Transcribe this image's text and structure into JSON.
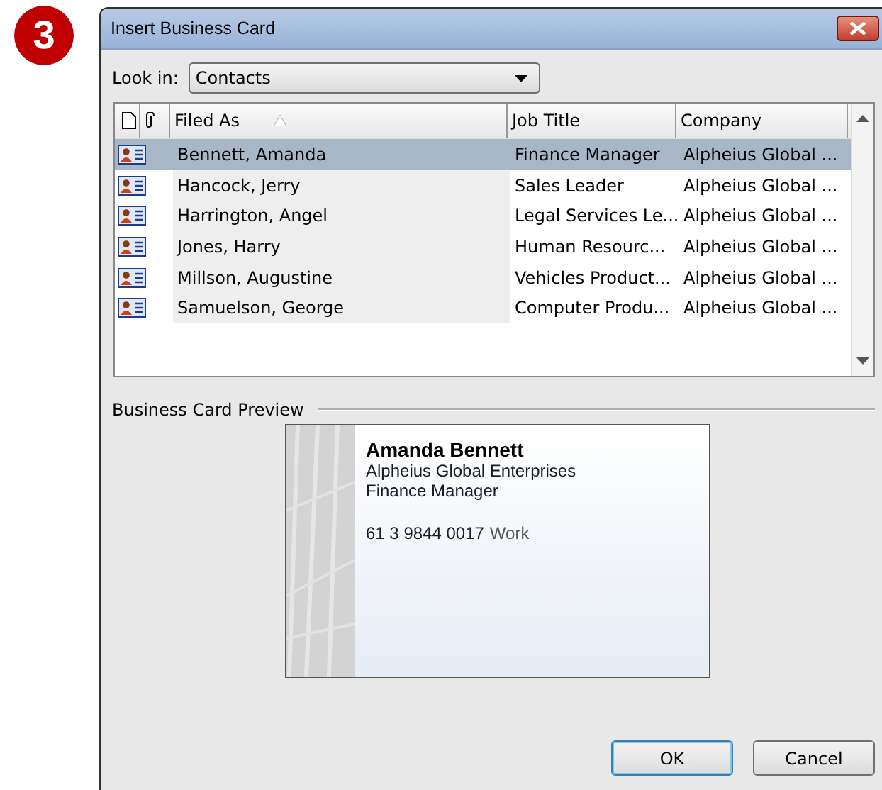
{
  "step_badge": "3",
  "window": {
    "title": "Insert Business Card"
  },
  "look_in": {
    "label": "Look in:",
    "value": "Contacts"
  },
  "table": {
    "columns": [
      "Filed As",
      "Job Title",
      "Company"
    ],
    "rows": [
      {
        "filed_as": "Bennett, Amanda",
        "job_title": "Finance Manager",
        "company": "Alpheius Global ...",
        "selected": true
      },
      {
        "filed_as": "Hancock, Jerry",
        "job_title": "Sales Leader",
        "company": "Alpheius Global ...",
        "selected": false
      },
      {
        "filed_as": "Harrington, Angel",
        "job_title": "Legal Services Le...",
        "company": "Alpheius Global ...",
        "selected": false
      },
      {
        "filed_as": "Jones, Harry",
        "job_title": "Human Resourc...",
        "company": "Alpheius Global ...",
        "selected": false
      },
      {
        "filed_as": "Millson, Augustine",
        "job_title": "Vehicles Product...",
        "company": "Alpheius Global ...",
        "selected": false
      },
      {
        "filed_as": "Samuelson, George",
        "job_title": "Computer Produ...",
        "company": "Alpheius Global ...",
        "selected": false
      }
    ]
  },
  "preview": {
    "label": "Business Card Preview",
    "name": "Amanda Bennett",
    "company": "Alpheius Global Enterprises",
    "job_title": "Finance Manager",
    "phone": "61 3 9844 0017",
    "phone_type": "Work"
  },
  "buttons": [
    "OK",
    "Cancel"
  ]
}
